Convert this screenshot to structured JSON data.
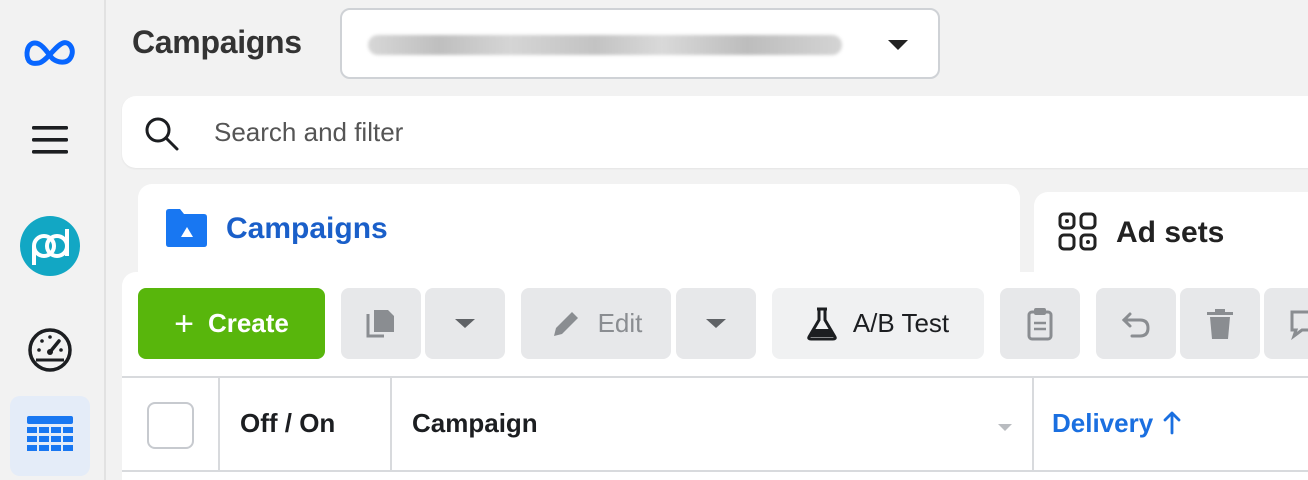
{
  "header": {
    "title": "Campaigns",
    "account_selector_value": ""
  },
  "search": {
    "placeholder": "Search and filter"
  },
  "tabs": [
    {
      "label": "Campaigns",
      "icon": "folder-icon",
      "active": true
    },
    {
      "label": "Ad sets",
      "icon": "grid-icon",
      "active": false
    }
  ],
  "toolbar": {
    "create_label": "Create",
    "edit_label": "Edit",
    "ab_test_label": "A/B Test"
  },
  "table": {
    "columns": [
      "Off / On",
      "Campaign",
      "Delivery"
    ],
    "sorted_column": "Delivery"
  },
  "colors": {
    "brand_blue": "#1a5fc9",
    "create_green": "#58b60c"
  }
}
